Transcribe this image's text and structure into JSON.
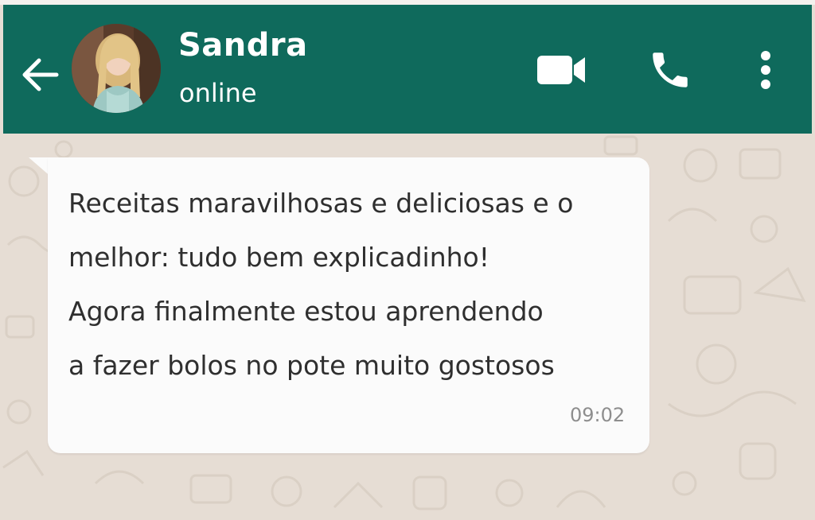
{
  "header": {
    "contact_name": "Sandra",
    "contact_status": "online",
    "bg_color": "#0f6a5c",
    "icons": {
      "back": "arrow-left-icon",
      "video": "video-camera-icon",
      "call": "phone-icon",
      "menu": "more-vertical-icon"
    }
  },
  "message": {
    "direction": "incoming",
    "lines": [
      "Receitas maravilhosas e deliciosas e o",
      "melhor: tudo bem explicadinho!",
      "Agora finalmente estou aprendendo",
      "a fazer bolos no pote muito gostosos"
    ],
    "time": "09:02",
    "bubble_color": "#fbfbfb"
  },
  "chat": {
    "wallpaper_color": "#e6ddd4"
  }
}
